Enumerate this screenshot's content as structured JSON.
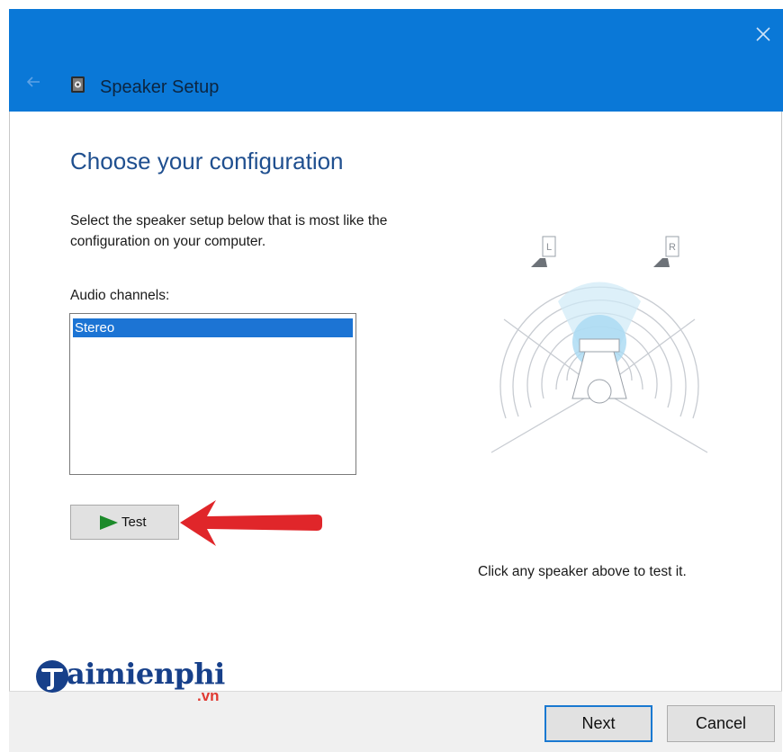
{
  "window": {
    "title": "Speaker Setup",
    "accent_color": "#0a78d7",
    "icons": {
      "back": "back-arrow-icon",
      "app": "speaker-setup-icon",
      "close": "close-icon"
    }
  },
  "main": {
    "heading": "Choose your configuration",
    "description": "Select the speaker setup below that is most like the configuration on your computer.",
    "channels_label": "Audio channels:",
    "channels": [
      {
        "label": "Stereo",
        "selected": true
      }
    ],
    "test_button": {
      "label": "Test",
      "icon": "play-icon"
    },
    "hint": "Click any speaker above to test it."
  },
  "diagram": {
    "left_speaker_label": "L",
    "right_speaker_label": "R"
  },
  "footer": {
    "next_label": "Next",
    "cancel_label": "Cancel"
  },
  "watermark": {
    "brand": "aimienphi",
    "suffix": ".vn"
  }
}
